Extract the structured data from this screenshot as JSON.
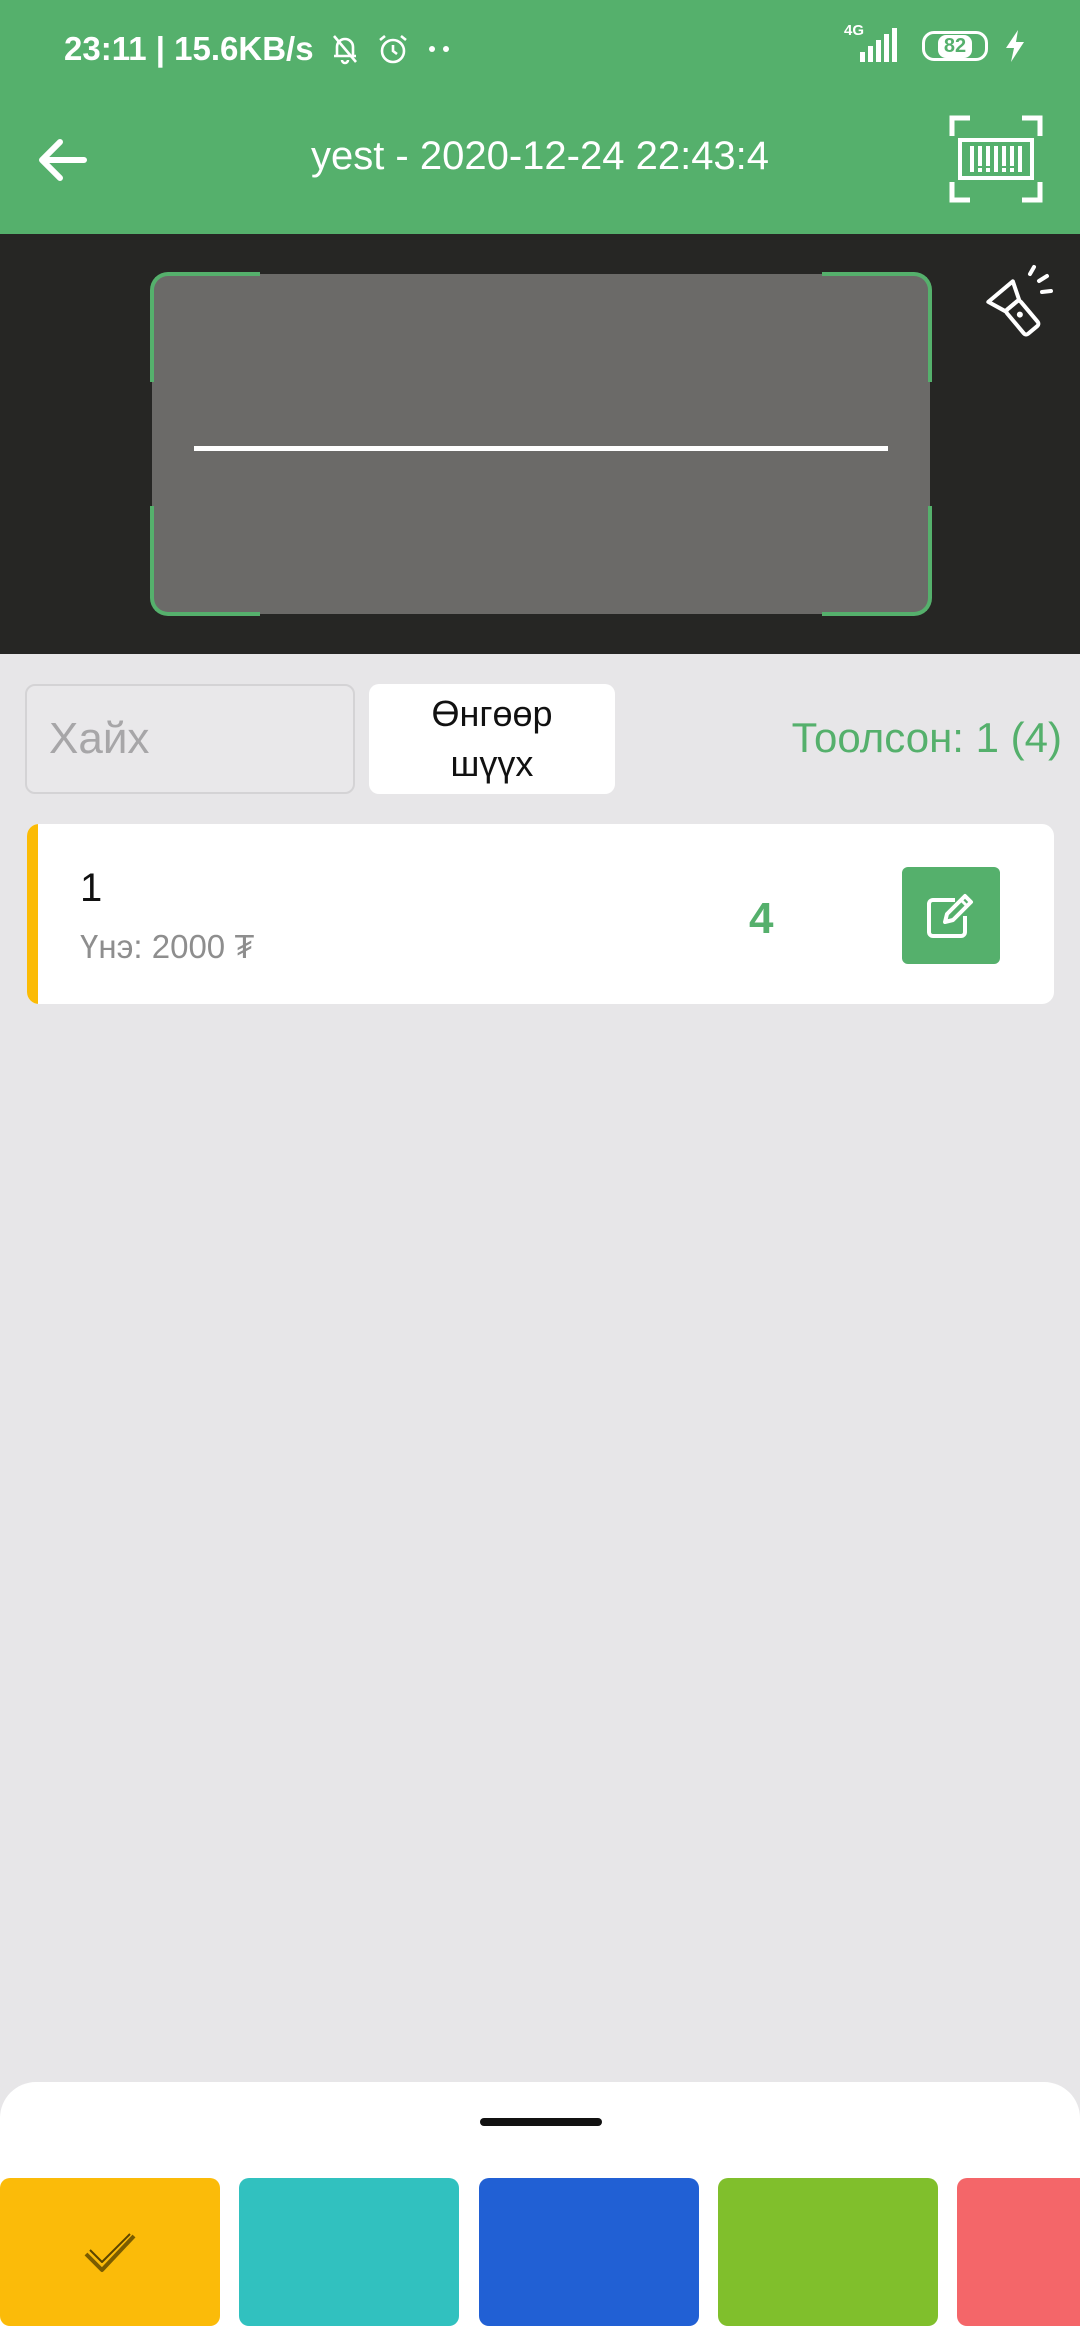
{
  "status_bar": {
    "time_speed": "23:11 | 15.6KB/s",
    "network": "4G",
    "battery": "82"
  },
  "app_bar": {
    "title": "yest - 2020-12-24 22:43:4"
  },
  "search": {
    "placeholder": "Хайх"
  },
  "filter": {
    "label_line1": "Өнгөөр",
    "label_line2": "шүүх"
  },
  "counted": "Тоолсон: 1 (4)",
  "items": [
    {
      "name": "1",
      "price": "Үнэ: 2000 ₮",
      "quantity": "4"
    }
  ],
  "color_swatches": [
    "#fbbb09",
    "#31c1bf",
    "#2160d4",
    "#80bf2c",
    "#f46669"
  ],
  "colors": {
    "brand": "#55b06c",
    "accent": "#fbbb05"
  }
}
